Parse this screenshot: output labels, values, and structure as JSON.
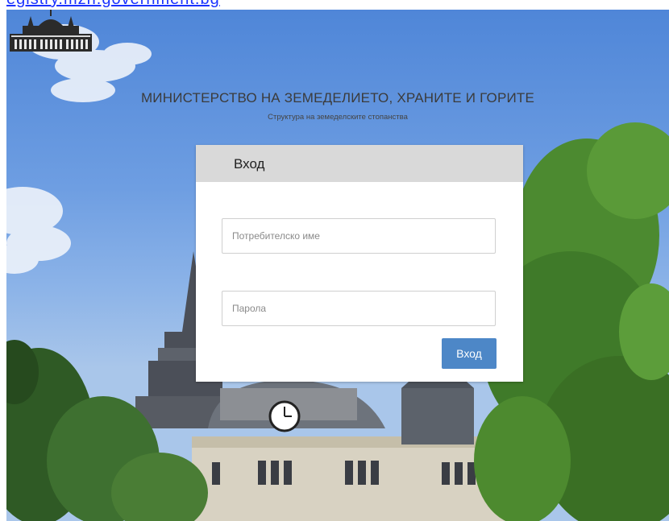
{
  "top_link": {
    "text": "egistry.mzh.government.bg"
  },
  "header": {
    "logo_icon": "ministry-building-icon",
    "title": "МИНИСТЕРСТВО НА ЗЕМЕДЕЛИЕТО, ХРАНИТЕ И ГОРИТЕ",
    "subtitle": "Структура на земеделските стопанства"
  },
  "login": {
    "heading": "Вход",
    "username_placeholder": "Потребителско име",
    "username_value": "",
    "password_placeholder": "Парола",
    "password_value": "",
    "submit_label": "Вход"
  },
  "colors": {
    "button": "#4d87c7",
    "panel_header": "#d9d9d9",
    "link": "#1a33ff"
  }
}
